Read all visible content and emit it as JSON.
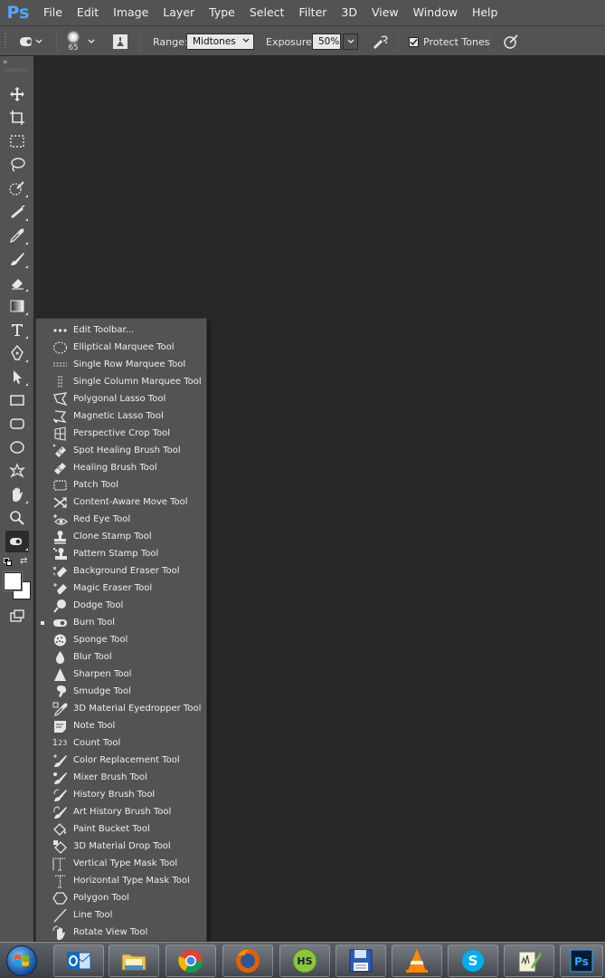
{
  "app": {
    "logo": "Ps"
  },
  "menu": [
    "File",
    "Edit",
    "Image",
    "Layer",
    "Type",
    "Select",
    "Filter",
    "3D",
    "View",
    "Window",
    "Help"
  ],
  "options": {
    "brush_size": "65",
    "range_label": "Range:",
    "range_value": "Midtones",
    "exposure_label": "Exposure:",
    "exposure_value": "50%",
    "protect_tones_label": "Protect Tones",
    "protect_tones_checked": true
  },
  "toolbar": {
    "tools": [
      "move-tool",
      "artboard-tool",
      "rectangular-marquee-tool",
      "lasso-tool",
      "quick-selection-tool",
      "crop-tool",
      "eyedropper-tool",
      "brush-tool",
      "eraser-tool",
      "gradient-tool",
      "type-tool",
      "pen-tool",
      "path-selection-tool",
      "rectangle-tool",
      "rounded-rectangle-tool",
      "ellipse-tool",
      "custom-shape-tool",
      "hand-tool",
      "zoom-tool",
      "burn-tool"
    ],
    "active_tool": "burn-tool"
  },
  "flyout": {
    "selected": "Burn Tool",
    "items": [
      {
        "label": "Edit Toolbar...",
        "icon": "dots-icon"
      },
      {
        "label": "Elliptical Marquee Tool",
        "icon": "elliptical-marquee-icon"
      },
      {
        "label": "Single Row Marquee Tool",
        "icon": "single-row-marquee-icon"
      },
      {
        "label": "Single Column Marquee Tool",
        "icon": "single-column-marquee-icon"
      },
      {
        "label": "Polygonal Lasso Tool",
        "icon": "polygonal-lasso-icon"
      },
      {
        "label": "Magnetic Lasso Tool",
        "icon": "magnetic-lasso-icon"
      },
      {
        "label": "Perspective Crop Tool",
        "icon": "perspective-crop-icon"
      },
      {
        "label": "Spot Healing Brush Tool",
        "icon": "spot-healing-icon"
      },
      {
        "label": "Healing Brush Tool",
        "icon": "healing-brush-icon"
      },
      {
        "label": "Patch Tool",
        "icon": "patch-icon"
      },
      {
        "label": "Content-Aware Move Tool",
        "icon": "content-aware-move-icon"
      },
      {
        "label": "Red Eye Tool",
        "icon": "red-eye-icon"
      },
      {
        "label": "Clone Stamp Tool",
        "icon": "clone-stamp-icon"
      },
      {
        "label": "Pattern Stamp Tool",
        "icon": "pattern-stamp-icon"
      },
      {
        "label": "Background Eraser Tool",
        "icon": "background-eraser-icon"
      },
      {
        "label": "Magic Eraser Tool",
        "icon": "magic-eraser-icon"
      },
      {
        "label": "Dodge Tool",
        "icon": "dodge-icon"
      },
      {
        "label": "Burn Tool",
        "icon": "burn-icon"
      },
      {
        "label": "Sponge Tool",
        "icon": "sponge-icon"
      },
      {
        "label": "Blur Tool",
        "icon": "blur-icon"
      },
      {
        "label": "Sharpen Tool",
        "icon": "sharpen-icon"
      },
      {
        "label": "Smudge Tool",
        "icon": "smudge-icon"
      },
      {
        "label": "3D Material Eyedropper Tool",
        "icon": "3d-eyedropper-icon"
      },
      {
        "label": "Note Tool",
        "icon": "note-icon"
      },
      {
        "label": "Count Tool",
        "icon": "count-icon"
      },
      {
        "label": "Color Replacement Tool",
        "icon": "color-replacement-icon"
      },
      {
        "label": "Mixer Brush Tool",
        "icon": "mixer-brush-icon"
      },
      {
        "label": "History Brush Tool",
        "icon": "history-brush-icon"
      },
      {
        "label": "Art History Brush Tool",
        "icon": "art-history-brush-icon"
      },
      {
        "label": "Paint Bucket Tool",
        "icon": "paint-bucket-icon"
      },
      {
        "label": "3D Material Drop Tool",
        "icon": "3d-material-drop-icon"
      },
      {
        "label": "Vertical Type Mask Tool",
        "icon": "vertical-type-mask-icon"
      },
      {
        "label": "Horizontal Type Mask Tool",
        "icon": "horizontal-type-mask-icon"
      },
      {
        "label": "Polygon Tool",
        "icon": "polygon-icon"
      },
      {
        "label": "Line Tool",
        "icon": "line-icon"
      },
      {
        "label": "Rotate View Tool",
        "icon": "rotate-view-icon"
      }
    ]
  },
  "taskbar": {
    "apps": [
      "outlook",
      "file-explorer",
      "chrome",
      "firefox",
      "hotspot-shield",
      "save-app",
      "vlc",
      "skype",
      "notepad-app",
      "photoshop"
    ]
  },
  "colors": {
    "accent": "#4ea8ff",
    "panel": "#535353",
    "canvas": "#282828"
  }
}
